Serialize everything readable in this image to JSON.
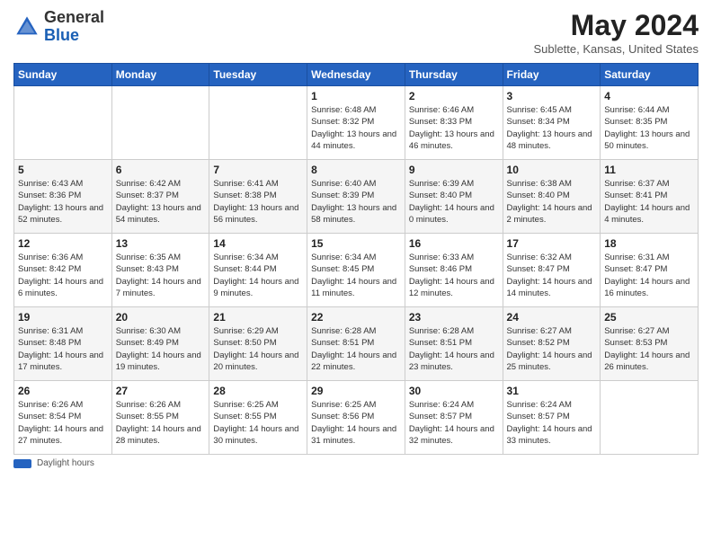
{
  "header": {
    "logo_general": "General",
    "logo_blue": "Blue",
    "title": "May 2024",
    "location": "Sublette, Kansas, United States"
  },
  "days_of_week": [
    "Sunday",
    "Monday",
    "Tuesday",
    "Wednesday",
    "Thursday",
    "Friday",
    "Saturday"
  ],
  "weeks": [
    [
      {
        "day": "",
        "info": ""
      },
      {
        "day": "",
        "info": ""
      },
      {
        "day": "",
        "info": ""
      },
      {
        "day": "1",
        "info": "Sunrise: 6:48 AM\nSunset: 8:32 PM\nDaylight: 13 hours\nand 44 minutes."
      },
      {
        "day": "2",
        "info": "Sunrise: 6:46 AM\nSunset: 8:33 PM\nDaylight: 13 hours\nand 46 minutes."
      },
      {
        "day": "3",
        "info": "Sunrise: 6:45 AM\nSunset: 8:34 PM\nDaylight: 13 hours\nand 48 minutes."
      },
      {
        "day": "4",
        "info": "Sunrise: 6:44 AM\nSunset: 8:35 PM\nDaylight: 13 hours\nand 50 minutes."
      }
    ],
    [
      {
        "day": "5",
        "info": "Sunrise: 6:43 AM\nSunset: 8:36 PM\nDaylight: 13 hours\nand 52 minutes."
      },
      {
        "day": "6",
        "info": "Sunrise: 6:42 AM\nSunset: 8:37 PM\nDaylight: 13 hours\nand 54 minutes."
      },
      {
        "day": "7",
        "info": "Sunrise: 6:41 AM\nSunset: 8:38 PM\nDaylight: 13 hours\nand 56 minutes."
      },
      {
        "day": "8",
        "info": "Sunrise: 6:40 AM\nSunset: 8:39 PM\nDaylight: 13 hours\nand 58 minutes."
      },
      {
        "day": "9",
        "info": "Sunrise: 6:39 AM\nSunset: 8:40 PM\nDaylight: 14 hours\nand 0 minutes."
      },
      {
        "day": "10",
        "info": "Sunrise: 6:38 AM\nSunset: 8:40 PM\nDaylight: 14 hours\nand 2 minutes."
      },
      {
        "day": "11",
        "info": "Sunrise: 6:37 AM\nSunset: 8:41 PM\nDaylight: 14 hours\nand 4 minutes."
      }
    ],
    [
      {
        "day": "12",
        "info": "Sunrise: 6:36 AM\nSunset: 8:42 PM\nDaylight: 14 hours\nand 6 minutes."
      },
      {
        "day": "13",
        "info": "Sunrise: 6:35 AM\nSunset: 8:43 PM\nDaylight: 14 hours\nand 7 minutes."
      },
      {
        "day": "14",
        "info": "Sunrise: 6:34 AM\nSunset: 8:44 PM\nDaylight: 14 hours\nand 9 minutes."
      },
      {
        "day": "15",
        "info": "Sunrise: 6:34 AM\nSunset: 8:45 PM\nDaylight: 14 hours\nand 11 minutes."
      },
      {
        "day": "16",
        "info": "Sunrise: 6:33 AM\nSunset: 8:46 PM\nDaylight: 14 hours\nand 12 minutes."
      },
      {
        "day": "17",
        "info": "Sunrise: 6:32 AM\nSunset: 8:47 PM\nDaylight: 14 hours\nand 14 minutes."
      },
      {
        "day": "18",
        "info": "Sunrise: 6:31 AM\nSunset: 8:47 PM\nDaylight: 14 hours\nand 16 minutes."
      }
    ],
    [
      {
        "day": "19",
        "info": "Sunrise: 6:31 AM\nSunset: 8:48 PM\nDaylight: 14 hours\nand 17 minutes."
      },
      {
        "day": "20",
        "info": "Sunrise: 6:30 AM\nSunset: 8:49 PM\nDaylight: 14 hours\nand 19 minutes."
      },
      {
        "day": "21",
        "info": "Sunrise: 6:29 AM\nSunset: 8:50 PM\nDaylight: 14 hours\nand 20 minutes."
      },
      {
        "day": "22",
        "info": "Sunrise: 6:28 AM\nSunset: 8:51 PM\nDaylight: 14 hours\nand 22 minutes."
      },
      {
        "day": "23",
        "info": "Sunrise: 6:28 AM\nSunset: 8:51 PM\nDaylight: 14 hours\nand 23 minutes."
      },
      {
        "day": "24",
        "info": "Sunrise: 6:27 AM\nSunset: 8:52 PM\nDaylight: 14 hours\nand 25 minutes."
      },
      {
        "day": "25",
        "info": "Sunrise: 6:27 AM\nSunset: 8:53 PM\nDaylight: 14 hours\nand 26 minutes."
      }
    ],
    [
      {
        "day": "26",
        "info": "Sunrise: 6:26 AM\nSunset: 8:54 PM\nDaylight: 14 hours\nand 27 minutes."
      },
      {
        "day": "27",
        "info": "Sunrise: 6:26 AM\nSunset: 8:55 PM\nDaylight: 14 hours\nand 28 minutes."
      },
      {
        "day": "28",
        "info": "Sunrise: 6:25 AM\nSunset: 8:55 PM\nDaylight: 14 hours\nand 30 minutes."
      },
      {
        "day": "29",
        "info": "Sunrise: 6:25 AM\nSunset: 8:56 PM\nDaylight: 14 hours\nand 31 minutes."
      },
      {
        "day": "30",
        "info": "Sunrise: 6:24 AM\nSunset: 8:57 PM\nDaylight: 14 hours\nand 32 minutes."
      },
      {
        "day": "31",
        "info": "Sunrise: 6:24 AM\nSunset: 8:57 PM\nDaylight: 14 hours\nand 33 minutes."
      },
      {
        "day": "",
        "info": ""
      }
    ]
  ],
  "footer": {
    "daylight_label": "Daylight hours"
  }
}
